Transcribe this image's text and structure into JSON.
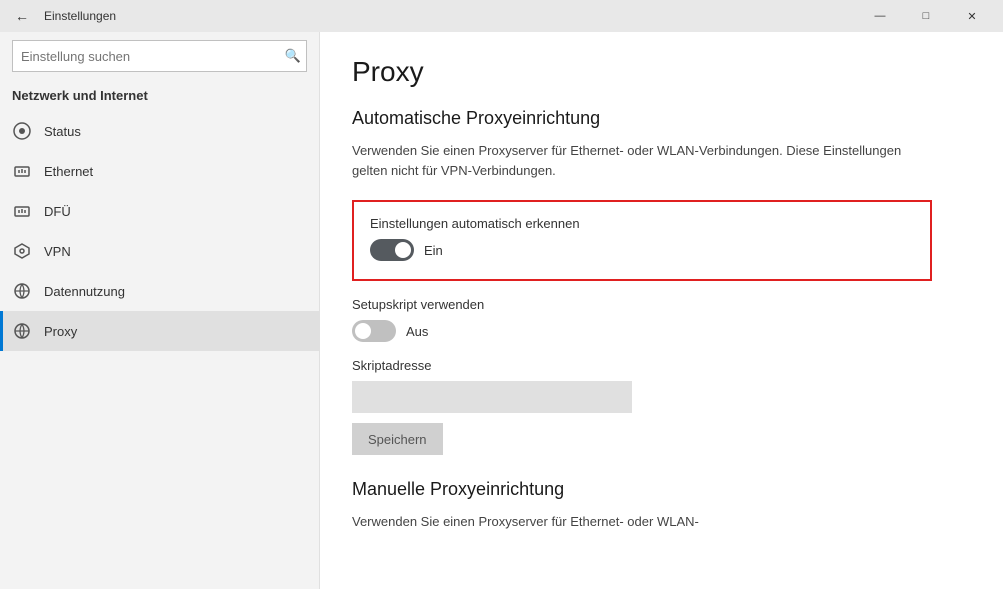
{
  "titlebar": {
    "back_label": "←",
    "title": "Einstellungen",
    "minimize_label": "—",
    "maximize_label": "□",
    "close_label": "✕"
  },
  "sidebar": {
    "search_placeholder": "Einstellung suchen",
    "search_icon": "🔍",
    "section_header": "Netzwerk und Internet",
    "nav_items": [
      {
        "id": "status",
        "label": "Status",
        "icon": "⊕"
      },
      {
        "id": "ethernet",
        "label": "Ethernet",
        "icon": "🖥"
      },
      {
        "id": "dfu",
        "label": "DFÜ",
        "icon": "🖥"
      },
      {
        "id": "vpn",
        "label": "VPN",
        "icon": "🔗"
      },
      {
        "id": "datennutzung",
        "label": "Datennutzung",
        "icon": "🌐"
      },
      {
        "id": "proxy",
        "label": "Proxy",
        "icon": "🌐"
      }
    ]
  },
  "content": {
    "page_title": "Proxy",
    "auto_section": {
      "title": "Automatische Proxyeinrichtung",
      "description": "Verwenden Sie einen Proxyserver für Ethernet- oder WLAN-Verbindungen. Diese Einstellungen gelten nicht für VPN-Verbindungen.",
      "auto_detect_label": "Einstellungen automatisch erkennen",
      "auto_detect_state": "Ein",
      "setup_script_label": "Setupskript verwenden",
      "setup_script_state": "Aus",
      "script_address_label": "Skriptadresse",
      "script_address_placeholder": "",
      "save_button_label": "Speichern"
    },
    "manual_section": {
      "title": "Manuelle Proxyeinrichtung",
      "description": "Verwenden Sie einen Proxyserver für Ethernet- oder WLAN-"
    }
  }
}
